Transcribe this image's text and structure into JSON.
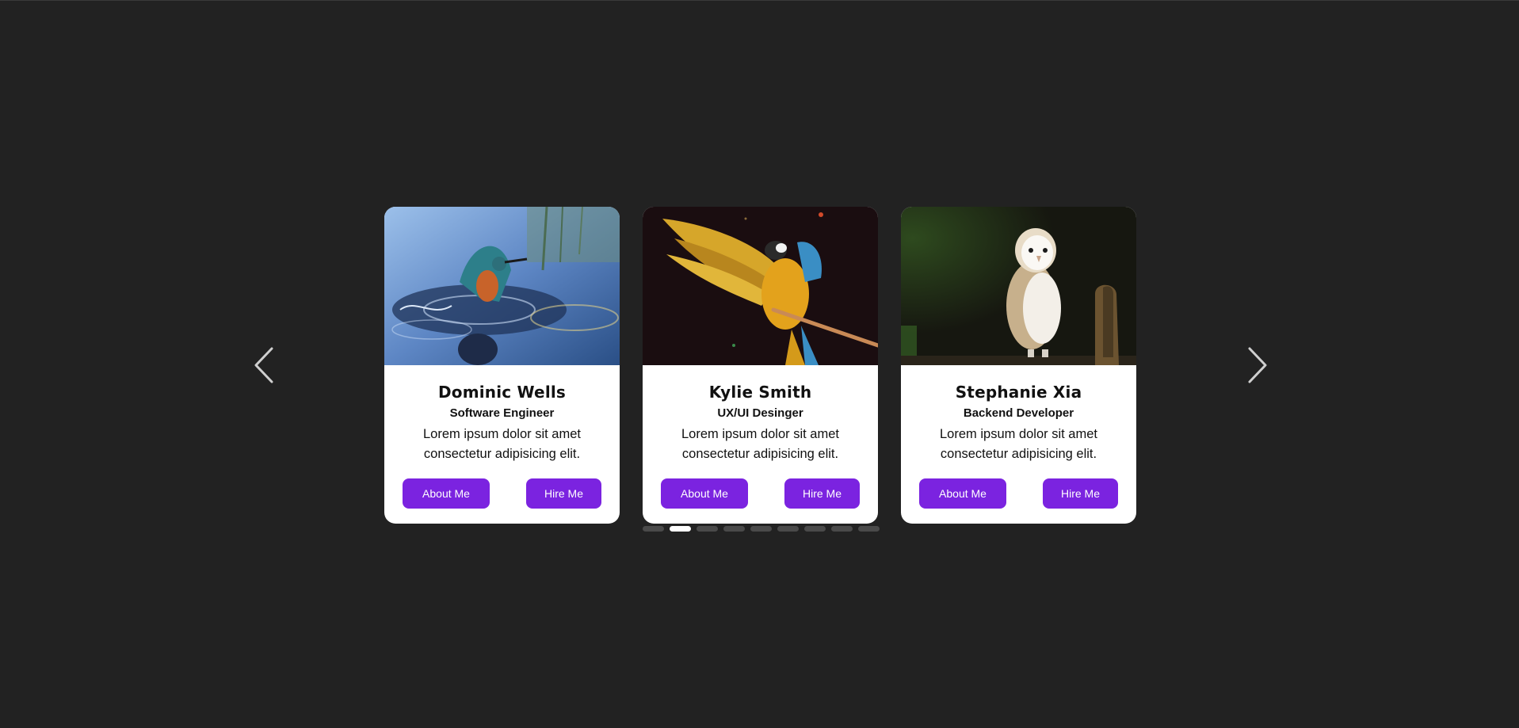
{
  "carousel": {
    "prev_icon": "chevron-left-icon",
    "next_icon": "chevron-right-icon",
    "cards": [
      {
        "name": "Dominic Wells",
        "role": "Software Engineer",
        "description": "Lorem ipsum dolor sit amet consectetur adipisicing elit.",
        "image": "kingfisher-splashing-photo",
        "about_label": "About Me",
        "hire_label": "Hire Me"
      },
      {
        "name": "Kylie Smith",
        "role": "UX/UI Desinger",
        "description": "Lorem ipsum dolor sit amet consectetur adipisicing elit.",
        "image": "macaw-parrot-photo",
        "about_label": "About Me",
        "hire_label": "Hire Me"
      },
      {
        "name": "Stephanie Xia",
        "role": "Backend Developer",
        "description": "Lorem ipsum dolor sit amet consectetur adipisicing elit.",
        "image": "barn-owl-photo",
        "about_label": "About Me",
        "hire_label": "Hire Me"
      }
    ],
    "pagination": {
      "total": 9,
      "active_index": 1
    }
  },
  "colors": {
    "background": "#222222",
    "accent": "#7b23e0",
    "card": "#ffffff",
    "dot_inactive": "#4a4a4a",
    "dot_active": "#ffffff"
  }
}
